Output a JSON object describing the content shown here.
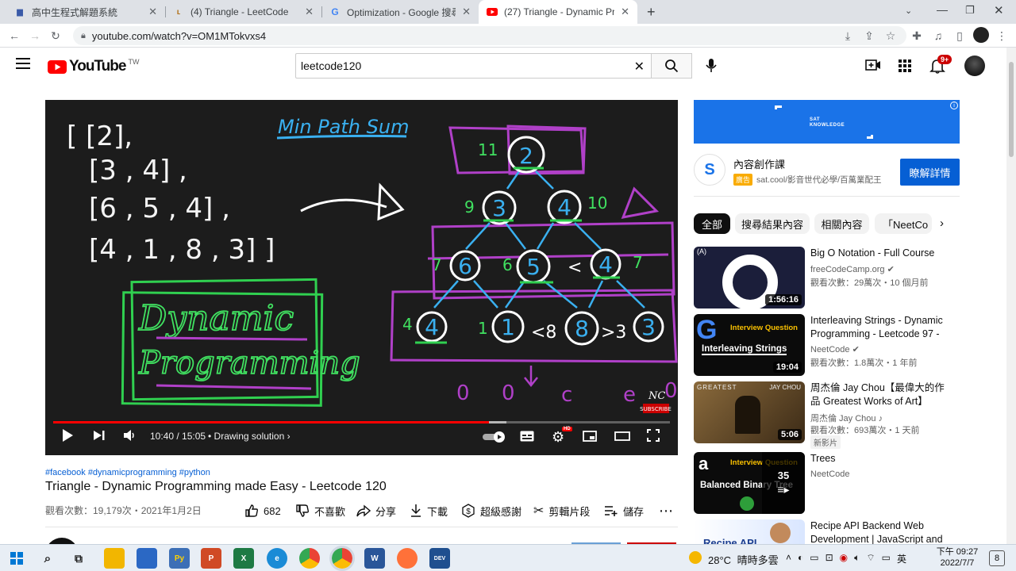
{
  "browser": {
    "tabs": [
      {
        "title": "高中生程式解題系統",
        "icon": "zerojudge-icon",
        "active": false
      },
      {
        "title": "(4) Triangle - LeetCode",
        "icon": "leetcode-icon",
        "active": false
      },
      {
        "title": "Optimization - Google 搜尋",
        "icon": "google-icon",
        "active": false
      },
      {
        "title": "(27) Triangle - Dynamic Progra",
        "icon": "youtube-icon",
        "active": true
      }
    ],
    "new_tab": "+",
    "url": "youtube.com/watch?v=OM1MTokvxs4"
  },
  "youtube": {
    "logo_text": "YouTube",
    "region": "TW",
    "search_value": "leetcode120",
    "notification_badge": "9+"
  },
  "video": {
    "board": {
      "rows": [
        "[ [2],",
        "[3 , 4] ,",
        "[6 , 5 , 4] ,",
        "[4 , 1 , 8 , 3] ]"
      ],
      "heading": "Min Path Sum",
      "dp_text_1": "Dynamic",
      "dp_text_2": "Programming",
      "tree_levels": [
        {
          "nodes": [
            "2"
          ],
          "sums": [
            "11"
          ]
        },
        {
          "nodes": [
            "3",
            "4"
          ],
          "sums": [
            "9",
            "10"
          ]
        },
        {
          "nodes": [
            "6",
            "5",
            "4"
          ],
          "sums": [
            "7",
            "6",
            "7"
          ]
        },
        {
          "nodes": [
            "4",
            "1",
            "8",
            "3"
          ],
          "sums": [
            "4",
            "1"
          ]
        }
      ],
      "compare_marks": [
        "<",
        "<8",
        ">3"
      ],
      "bottom_letters": [
        "0",
        "0",
        "c",
        "e",
        "0"
      ],
      "brand": "NC",
      "subscribe": "SUBSCRIBE"
    },
    "time_current": "10:40",
    "time_total": "15:05",
    "time_sep": " / ",
    "chapter": "Drawing solution",
    "progress_fraction": 0.707,
    "buffered_fraction": 0.735,
    "hd_badge": "HD",
    "hashtags": "#facebook #dynamicprogramming #python",
    "title": "Triangle - Dynamic Programming made Easy - Leetcode 120",
    "views_date": "觀看次數：19,179次・2021年1月2日",
    "actions": {
      "like_count": "682",
      "dislike": "不喜歡",
      "share": "分享",
      "download": "下載",
      "thanks": "超級感謝",
      "clip": "剪輯片段",
      "save": "儲存"
    }
  },
  "ad": {
    "banner_line1": "SAT",
    "banner_line2": "KNOWLEDGE",
    "title": "內容創作課",
    "badge": "廣告",
    "url": "sat.cool/影音世代必學/百萬業配王",
    "cta": "瞭解詳情"
  },
  "chips": [
    "全部",
    "搜尋結果內容",
    "相關內容",
    "「NeetCo"
  ],
  "recommendations": [
    {
      "title": "Big O Notation - Full Course",
      "channel": "freeCodeCamp.org",
      "verified": true,
      "stats": "觀看次數：29萬次・10 個月前",
      "duration": "1:56:16",
      "thumb_text": "O",
      "badge": ""
    },
    {
      "title": "Interleaving Strings - Dynamic Programming - Leetcode 97 - Python",
      "channel": "NeetCode",
      "verified": true,
      "stats": "觀看次數：1.8萬次・1 年前",
      "duration": "19:04",
      "thumb_text": "Interleaving Strings",
      "thumb_sub": "Interview Question",
      "badge": ""
    },
    {
      "title": "周杰倫 Jay Chou【最偉大的作品 Greatest Works of Art】Official MV",
      "channel": "周杰倫 Jay Chou",
      "verified": false,
      "stats": "觀看次數：693萬次・1 天前",
      "duration": "5:06",
      "thumb_text": "GREATEST",
      "thumb_sub": "JAY CHOU",
      "badge": "新影片"
    },
    {
      "title": "Trees",
      "channel": "NeetCode",
      "verified": false,
      "stats": "",
      "duration": "",
      "thumb_text": "Balanced Binary Tree",
      "thumb_sub": "Interview Question",
      "playlist_count": "35",
      "badge": ""
    },
    {
      "title": "Recipe API Backend Web Development | JavaScript and Express",
      "channel": "",
      "verified": false,
      "stats": "",
      "duration": "",
      "thumb_text": "Recipe API",
      "badge": ""
    }
  ],
  "taskbar": {
    "temperature": "28°C",
    "weather": "晴時多雲",
    "time": "下午 09:27",
    "date": "2022/7/7",
    "notif_count": "8"
  }
}
